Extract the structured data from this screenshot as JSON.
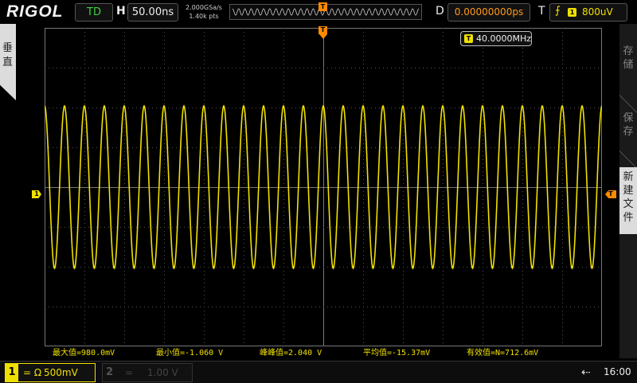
{
  "topbar": {
    "logo": "RIGOL",
    "run_state": "TD",
    "timebase_label": "H",
    "timebase": "50.00ns",
    "sample_rate": "2.000GSa/s",
    "memory_depth": "1.40k pts",
    "delay_label": "D",
    "delay": "0.00000000ps",
    "trigger_label": "T",
    "trigger_source": "1",
    "trigger_level": "800uV",
    "trigger_marker": "T"
  },
  "left_menu": {
    "label": "垂直"
  },
  "right_menu": {
    "items": [
      "存储",
      "保存",
      "新建文件"
    ]
  },
  "plot": {
    "ch1_marker": "1",
    "trig_marker": "T",
    "tpos_marker": "T",
    "frequency_badge": "T",
    "frequency": "40.0000MHz",
    "waveform": {
      "frequency_hz": 40000000,
      "amplitude_v": 1.02,
      "volts_per_div": 0.5,
      "time_per_div_ns": 50,
      "h_divs": 14,
      "v_divs": 8
    },
    "colors": {
      "ch1": "#f0e000",
      "trigger": "#ff8a00",
      "grid": "#555555"
    }
  },
  "measurements": [
    {
      "label": "最大值=980.0mV"
    },
    {
      "label": "最小值=-1.060 V"
    },
    {
      "label": "峰峰值=2.040 V"
    },
    {
      "label": "平均值=-15.37mV"
    },
    {
      "label": "有效值=N=712.6mV"
    }
  ],
  "bottombar": {
    "ch1_number": "1",
    "ch1_coupling": "= Ω",
    "ch1_scale": "500mV",
    "ch2_number": "2",
    "ch2_coupling": "= ",
    "ch2_scale": "1.00 V",
    "usb_icon": "usb-icon",
    "time": "16:00"
  }
}
